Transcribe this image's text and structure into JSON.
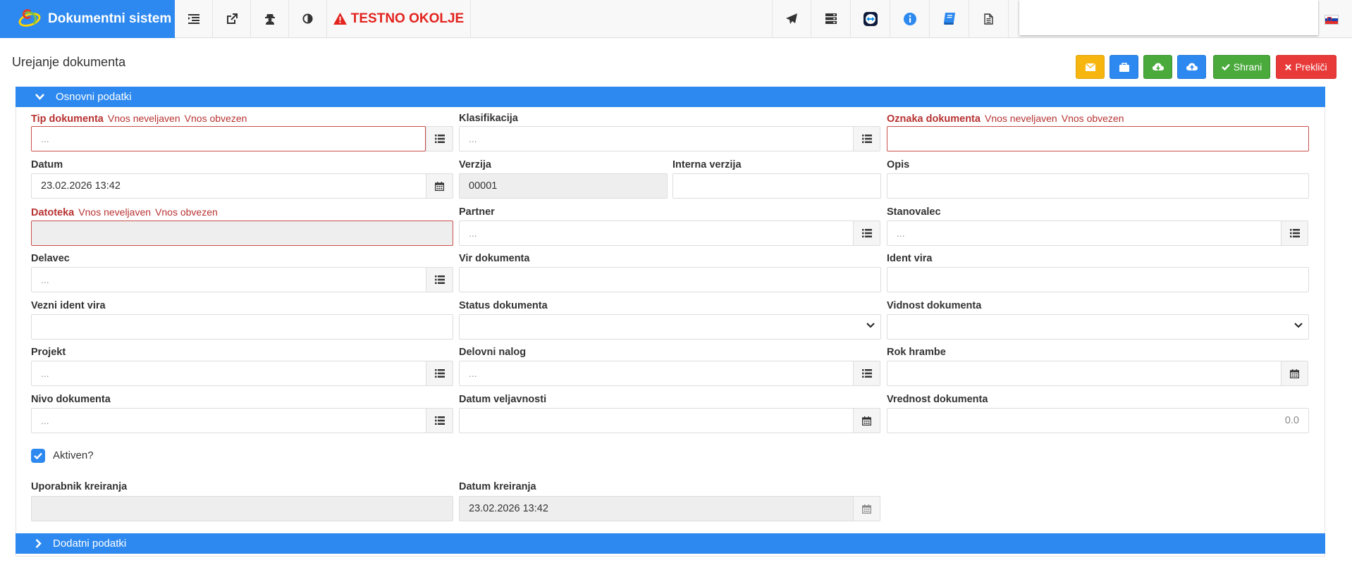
{
  "navbar": {
    "brand": "Dokumentni sistem",
    "test_env": "TESTNO OKOLJE"
  },
  "header": {
    "title": "Urejanje dokumenta",
    "save_label": "Shrani",
    "cancel_label": "Prekliči"
  },
  "panels": {
    "basic": "Osnovni podatki",
    "extra": "Dodatni podatki"
  },
  "validation": {
    "invalid": "Vnos neveljaven",
    "required": "Vnos obvezen"
  },
  "fields": {
    "tip_dokumenta": {
      "label": "Tip dokumenta",
      "placeholder": "..."
    },
    "klasifikacija": {
      "label": "Klasifikacija",
      "placeholder": "..."
    },
    "oznaka_dokumenta": {
      "label": "Oznaka dokumenta",
      "value": ""
    },
    "datum": {
      "label": "Datum",
      "value": "23.02.2026 13:42"
    },
    "verzija": {
      "label": "Verzija",
      "value": "00001"
    },
    "interna_verzija": {
      "label": "Interna verzija",
      "value": ""
    },
    "opis": {
      "label": "Opis",
      "value": ""
    },
    "datoteka": {
      "label": "Datoteka",
      "value": ""
    },
    "partner": {
      "label": "Partner",
      "placeholder": "..."
    },
    "stanovalec": {
      "label": "Stanovalec",
      "placeholder": "..."
    },
    "delavec": {
      "label": "Delavec",
      "placeholder": "..."
    },
    "vir_dokumenta": {
      "label": "Vir dokumenta",
      "value": ""
    },
    "ident_vira": {
      "label": "Ident vira",
      "value": ""
    },
    "vezni_ident_vira": {
      "label": "Vezni ident vira",
      "value": ""
    },
    "status_dokumenta": {
      "label": "Status dokumenta",
      "value": ""
    },
    "vidnost_dokumenta": {
      "label": "Vidnost dokumenta",
      "value": ""
    },
    "projekt": {
      "label": "Projekt",
      "placeholder": "..."
    },
    "delovni_nalog": {
      "label": "Delovni nalog",
      "placeholder": "..."
    },
    "rok_hrambe": {
      "label": "Rok hrambe",
      "value": ""
    },
    "nivo_dokumenta": {
      "label": "Nivo dokumenta",
      "placeholder": "..."
    },
    "datum_veljavnosti": {
      "label": "Datum veljavnosti",
      "value": ""
    },
    "vrednost_dokumenta": {
      "label": "Vrednost dokumenta",
      "value": "0.0"
    },
    "aktiven": {
      "label": "Aktiven?",
      "checked": true
    },
    "uporabnik_kreiranja": {
      "label": "Uporabnik kreiranja",
      "value": ""
    },
    "datum_kreiranja": {
      "label": "Datum kreiranja",
      "value": "23.02.2026 13:42"
    }
  },
  "icons": {
    "nav_left": [
      "indent-list-icon",
      "external-link-icon",
      "user-secret-icon",
      "contrast-icon"
    ],
    "test_env": "warning-icon",
    "nav_right": [
      "paper-plane-icon",
      "server-icon",
      "teamviewer-icon",
      "info-icon",
      "book-icon",
      "document-icon"
    ],
    "field_addons": [
      "list-icon",
      "calendar-icon"
    ],
    "language_flag": "slovenia-flag-icon"
  },
  "colors": {
    "primary": "#2d89ef",
    "warning": "#f7b50f",
    "success": "#4aaa3c",
    "danger": "#e93a3a",
    "error_text": "#b83232"
  }
}
